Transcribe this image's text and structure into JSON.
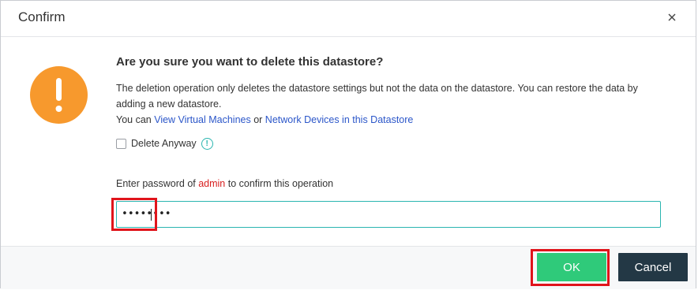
{
  "dialog": {
    "title": "Confirm",
    "close_icon": "close-icon"
  },
  "warning": {
    "icon": "exclamation-icon",
    "question": "Are you sure you want to delete this datastore?",
    "description": "The deletion operation only deletes the datastore settings but not the data on the datastore. You can restore the data by adding a new datastore.",
    "links_prefix": "You can ",
    "link_vms": "View Virtual Machines",
    "links_or": " or ",
    "link_network": "Network Devices in this Datastore"
  },
  "delete_anyway": {
    "label": "Delete Anyway",
    "checked": false,
    "info_icon": "info-icon"
  },
  "password": {
    "label_prefix": "Enter password of ",
    "user": "admin",
    "label_suffix": " to confirm this operation",
    "value": "••••••••"
  },
  "footer": {
    "ok_label": "OK",
    "cancel_label": "Cancel"
  },
  "colors": {
    "warning": "#f7992d",
    "ok": "#2fca7a",
    "cancel": "#233845",
    "link": "#2b56c9",
    "user": "#d81e1e",
    "highlight": "#e0141b"
  }
}
